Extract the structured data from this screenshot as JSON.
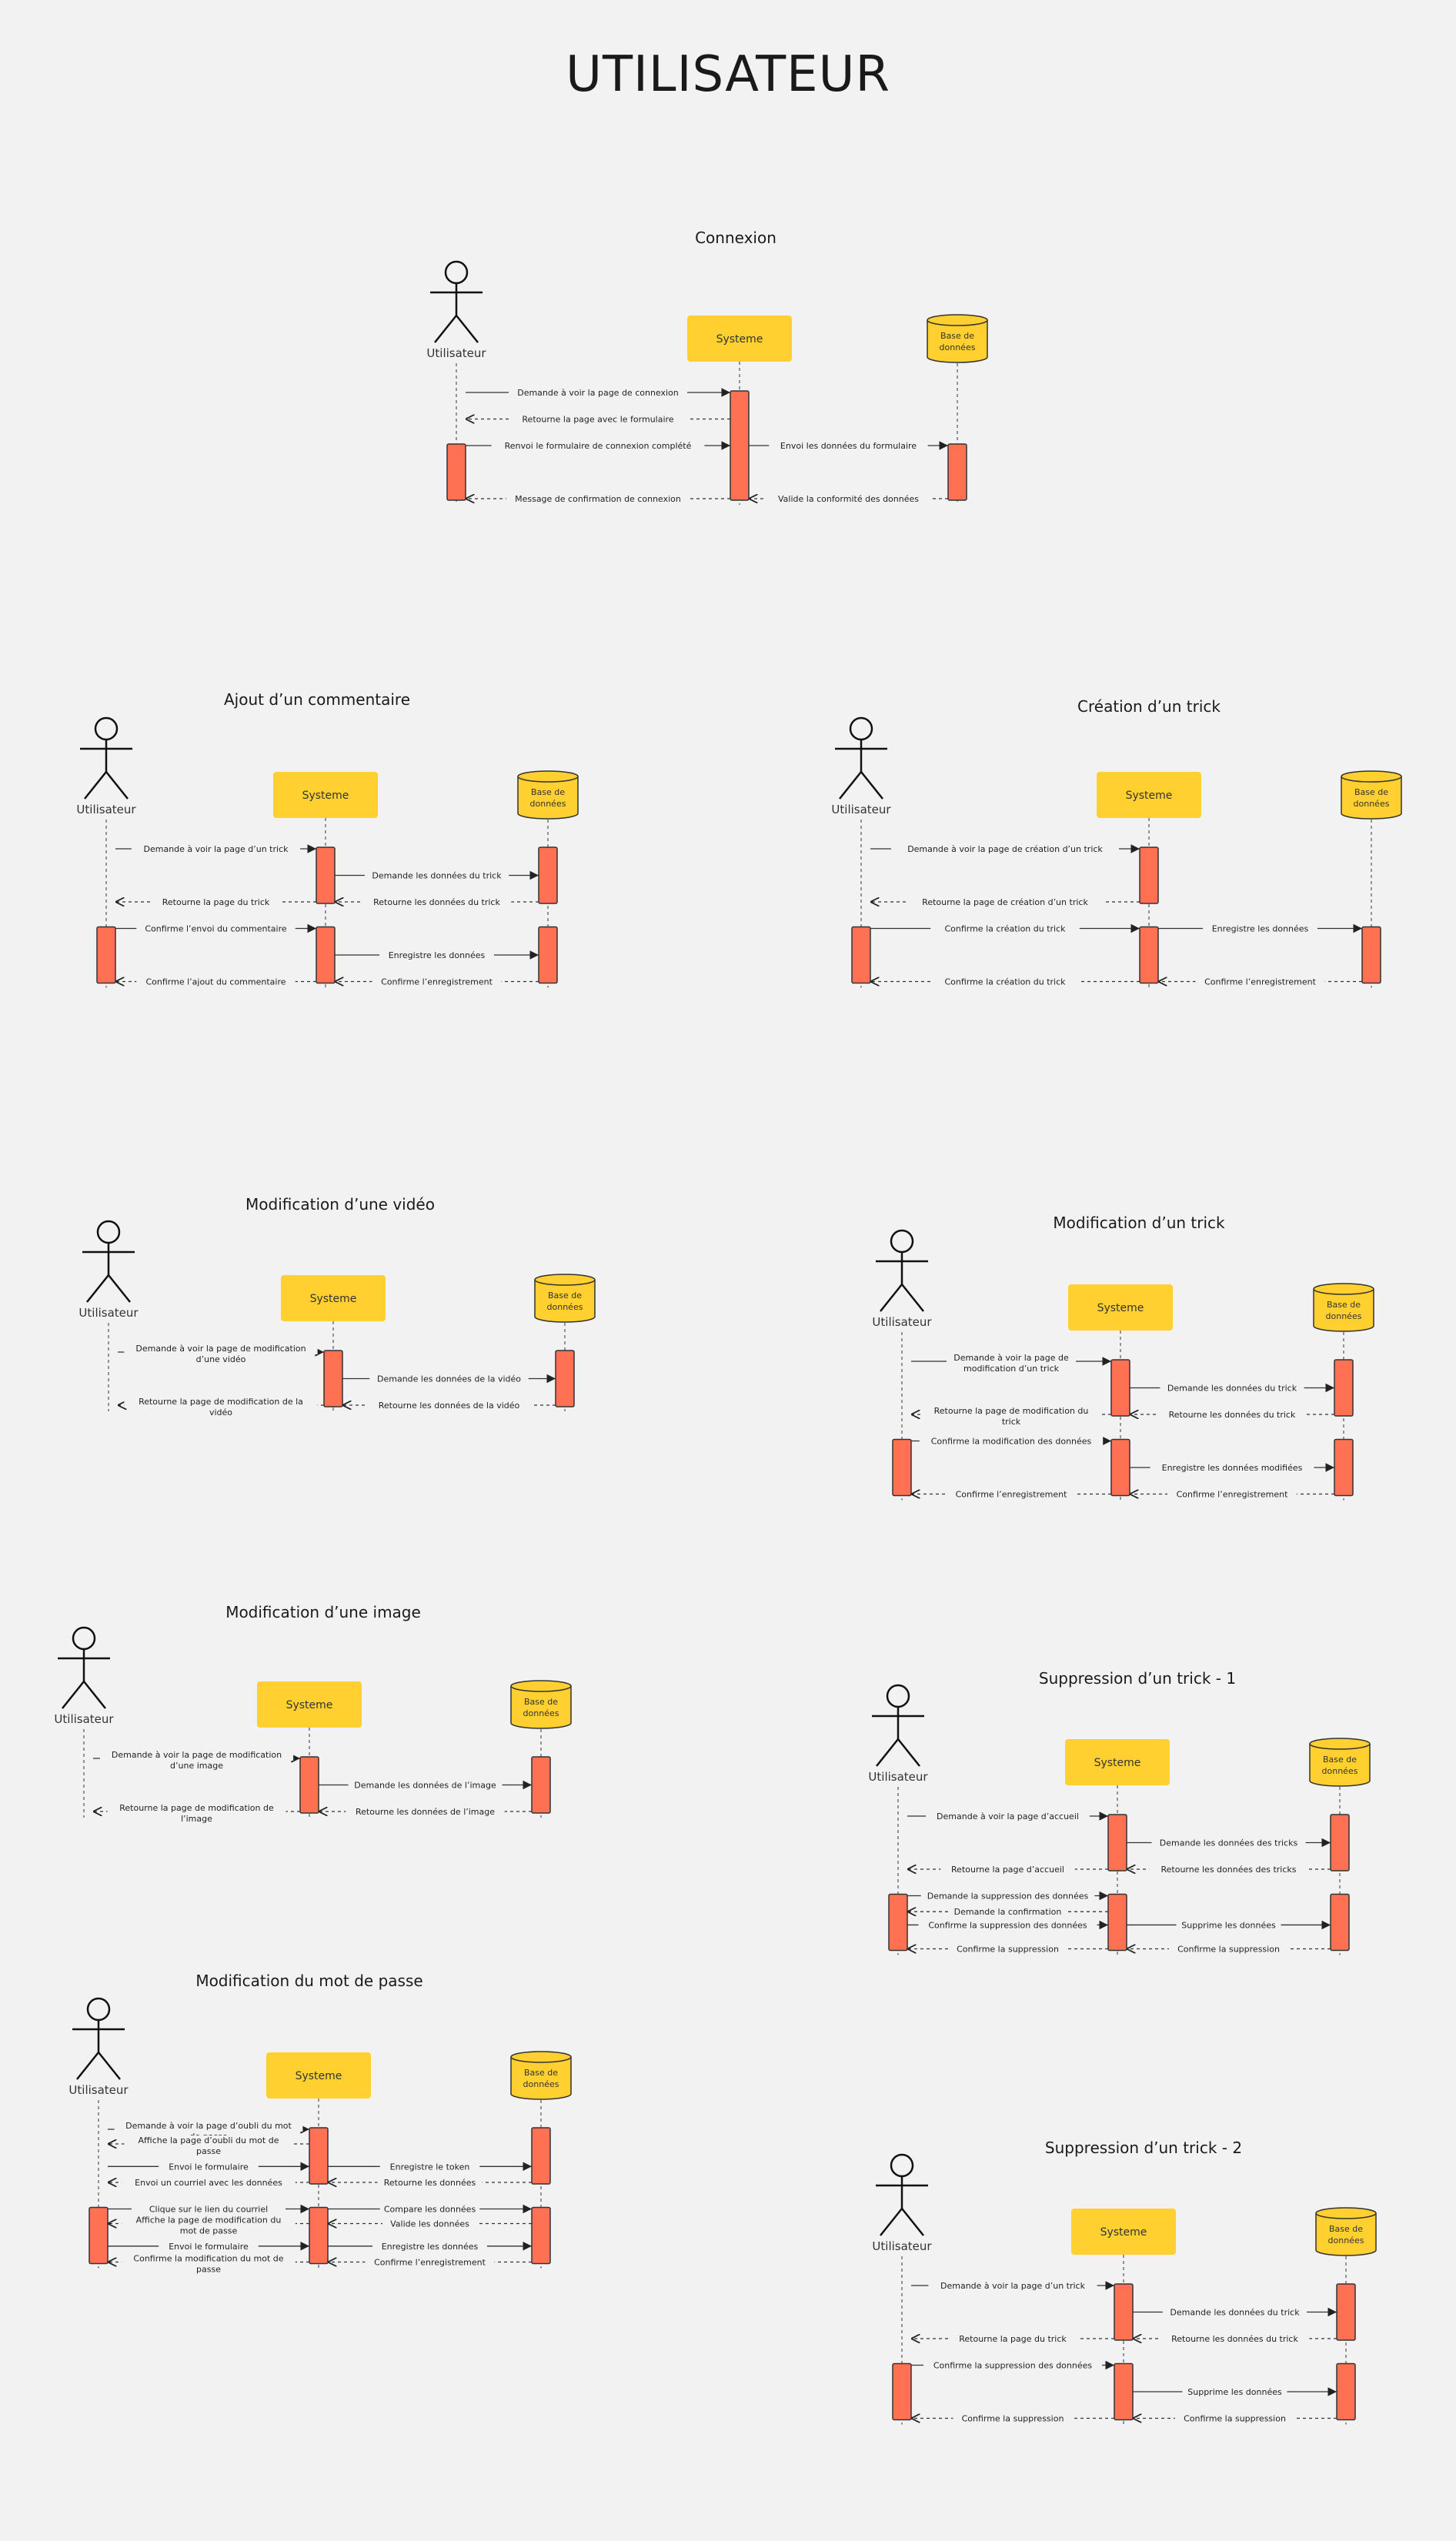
{
  "title": "UTILISATEUR",
  "colors": {
    "background": "#f2f2f2",
    "system_box": "#ffd02f",
    "database": "#ffd02f",
    "activation": "#ff7152",
    "line": "#333333"
  },
  "labels": {
    "actor": "Utilisateur",
    "system": "Systeme",
    "database": "Base de données"
  },
  "diagrams": [
    {
      "id": "connexion",
      "title": "Connexion",
      "activations": [
        {
          "lane": "S",
          "start": 0,
          "end": 4
        },
        {
          "lane": "U",
          "start": 2,
          "end": 4
        },
        {
          "lane": "D",
          "start": 2,
          "end": 4
        }
      ],
      "messages": [
        {
          "row": 0,
          "from": "U",
          "to": "S",
          "text": "Demande à voir la page de connexion",
          "type": "sync"
        },
        {
          "row": 1,
          "from": "S",
          "to": "U",
          "text": "Retourne la page avec le formulaire",
          "type": "return"
        },
        {
          "row": 2,
          "from": "U",
          "to": "S",
          "text": "Renvoi le formulaire de connexion complété",
          "type": "sync"
        },
        {
          "row": 2,
          "from": "S",
          "to": "D",
          "text": "Envoi les données du formulaire",
          "type": "sync"
        },
        {
          "row": 4,
          "from": "S",
          "to": "U",
          "text": "Message de confirmation de connexion",
          "type": "return"
        },
        {
          "row": 4,
          "from": "D",
          "to": "S",
          "text": "Valide la conformité des données",
          "type": "return"
        }
      ]
    },
    {
      "id": "ajout-commentaire",
      "title": "Ajout d’un commentaire",
      "activations": [
        {
          "lane": "S",
          "start": 0,
          "end": 2
        },
        {
          "lane": "D",
          "start": 0,
          "end": 2
        },
        {
          "lane": "U",
          "start": 3,
          "end": 5
        },
        {
          "lane": "S",
          "start": 3,
          "end": 5
        },
        {
          "lane": "D",
          "start": 3,
          "end": 5
        }
      ],
      "messages": [
        {
          "row": 0,
          "from": "U",
          "to": "S",
          "text": "Demande à voir la page d’un trick",
          "type": "sync"
        },
        {
          "row": 1,
          "from": "S",
          "to": "D",
          "text": "Demande les données du trick",
          "type": "sync"
        },
        {
          "row": 2,
          "from": "S",
          "to": "U",
          "text": "Retourne la page du trick",
          "type": "return"
        },
        {
          "row": 2,
          "from": "D",
          "to": "S",
          "text": "Retourne les données du trick",
          "type": "return"
        },
        {
          "row": 3,
          "from": "U",
          "to": "S",
          "text": "Confirme l’envoi du commentaire",
          "type": "sync"
        },
        {
          "row": 4,
          "from": "S",
          "to": "D",
          "text": "Enregistre les données",
          "type": "sync"
        },
        {
          "row": 5,
          "from": "S",
          "to": "U",
          "text": "Confirme l’ajout du commentaire",
          "type": "return"
        },
        {
          "row": 5,
          "from": "D",
          "to": "S",
          "text": "Confirme l’enregistrement",
          "type": "return"
        }
      ]
    },
    {
      "id": "creation-trick",
      "title": "Création d’un trick",
      "activations": [
        {
          "lane": "S",
          "start": 0,
          "end": 2
        },
        {
          "lane": "U",
          "start": 3,
          "end": 5
        },
        {
          "lane": "S",
          "start": 3,
          "end": 5
        },
        {
          "lane": "D",
          "start": 3,
          "end": 5
        }
      ],
      "messages": [
        {
          "row": 0,
          "from": "U",
          "to": "S",
          "text": "Demande à voir la page de création d’un trick",
          "type": "sync"
        },
        {
          "row": 2,
          "from": "S",
          "to": "U",
          "text": "Retourne la page de création d’un trick",
          "type": "return"
        },
        {
          "row": 3,
          "from": "U",
          "to": "S",
          "text": "Confirme la création du trick",
          "type": "sync"
        },
        {
          "row": 3,
          "from": "S",
          "to": "D",
          "text": "Enregistre les données",
          "type": "sync"
        },
        {
          "row": 5,
          "from": "S",
          "to": "U",
          "text": "Confirme la création du trick",
          "type": "return"
        },
        {
          "row": 5,
          "from": "D",
          "to": "S",
          "text": "Confirme l’enregistrement",
          "type": "return"
        }
      ]
    },
    {
      "id": "modification-video",
      "title": "Modification d’une vidéo",
      "activations": [
        {
          "lane": "S",
          "start": 0,
          "end": 2
        },
        {
          "lane": "D",
          "start": 0,
          "end": 2
        }
      ],
      "messages": [
        {
          "row": 0,
          "from": "U",
          "to": "S",
          "text": "Demande à voir la page de modification d’une vidéo",
          "type": "sync"
        },
        {
          "row": 1,
          "from": "S",
          "to": "D",
          "text": "Demande les données de la vidéo",
          "type": "sync"
        },
        {
          "row": 2,
          "from": "S",
          "to": "U",
          "text": "Retourne la page de modification de la vidéo",
          "type": "return"
        },
        {
          "row": 2,
          "from": "D",
          "to": "S",
          "text": "Retourne les données de la vidéo",
          "type": "return"
        }
      ]
    },
    {
      "id": "modification-trick",
      "title": "Modification d’un trick",
      "activations": [
        {
          "lane": "S",
          "start": 0,
          "end": 2
        },
        {
          "lane": "D",
          "start": 0,
          "end": 2
        },
        {
          "lane": "U",
          "start": 3,
          "end": 5
        },
        {
          "lane": "S",
          "start": 3,
          "end": 5
        },
        {
          "lane": "D",
          "start": 3,
          "end": 5
        }
      ],
      "messages": [
        {
          "row": 0,
          "from": "U",
          "to": "S",
          "text": "Demande à voir la page  de modification d’un trick",
          "type": "sync"
        },
        {
          "row": 1,
          "from": "S",
          "to": "D",
          "text": "Demande les données du trick",
          "type": "sync"
        },
        {
          "row": 2,
          "from": "S",
          "to": "U",
          "text": "Retourne la page  de modification du trick",
          "type": "return"
        },
        {
          "row": 2,
          "from": "D",
          "to": "S",
          "text": "Retourne les données du trick",
          "type": "return"
        },
        {
          "row": 3,
          "from": "U",
          "to": "S",
          "text": "Confirme la modification des données",
          "type": "sync"
        },
        {
          "row": 4,
          "from": "S",
          "to": "D",
          "text": "Enregistre les données modifiées",
          "type": "sync"
        },
        {
          "row": 5,
          "from": "S",
          "to": "U",
          "text": "Confirme l’enregistrement",
          "type": "return"
        },
        {
          "row": 5,
          "from": "D",
          "to": "S",
          "text": "Confirme l’enregistrement",
          "type": "return"
        }
      ]
    },
    {
      "id": "modification-image",
      "title": "Modification d’une image",
      "activations": [
        {
          "lane": "S",
          "start": 0,
          "end": 2
        },
        {
          "lane": "D",
          "start": 0,
          "end": 2
        }
      ],
      "messages": [
        {
          "row": 0,
          "from": "U",
          "to": "S",
          "text": "Demande à voir la page de modification d’une image",
          "type": "sync"
        },
        {
          "row": 1,
          "from": "S",
          "to": "D",
          "text": "Demande les données de l’image",
          "type": "sync"
        },
        {
          "row": 2,
          "from": "S",
          "to": "U",
          "text": "Retourne la page de modification de l’image",
          "type": "return"
        },
        {
          "row": 2,
          "from": "D",
          "to": "S",
          "text": "Retourne les données de l’image",
          "type": "return"
        }
      ]
    },
    {
      "id": "suppression-trick-1",
      "title": "Suppression d’un trick - 1",
      "activations": [
        {
          "lane": "S",
          "start": 0,
          "end": 2
        },
        {
          "lane": "D",
          "start": 0,
          "end": 2
        },
        {
          "lane": "U",
          "start": 3,
          "end": 5
        },
        {
          "lane": "S",
          "start": 3,
          "end": 5
        },
        {
          "lane": "D",
          "start": 3,
          "end": 5
        }
      ],
      "messages": [
        {
          "row": 0,
          "from": "U",
          "to": "S",
          "text": "Demande à voir la page d’accueil",
          "type": "sync"
        },
        {
          "row": 1,
          "from": "S",
          "to": "D",
          "text": "Demande les données des tricks",
          "type": "sync"
        },
        {
          "row": 2,
          "from": "S",
          "to": "U",
          "text": "Retourne la page d’accueil",
          "type": "return"
        },
        {
          "row": 2,
          "from": "D",
          "to": "S",
          "text": "Retourne les données des tricks",
          "type": "return"
        },
        {
          "row": 3,
          "from": "U",
          "to": "S",
          "text": "Demande la suppression des données",
          "type": "sync"
        },
        {
          "row": 3.6,
          "from": "S",
          "to": "U",
          "text": "Demande la confirmation",
          "type": "return"
        },
        {
          "row": 4.1,
          "from": "U",
          "to": "S",
          "text": "Confirme la suppression des données",
          "type": "sync"
        },
        {
          "row": 4.1,
          "from": "S",
          "to": "D",
          "text": "Supprime les données",
          "type": "sync"
        },
        {
          "row": 5,
          "from": "S",
          "to": "U",
          "text": "Confirme la suppression",
          "type": "return"
        },
        {
          "row": 5,
          "from": "D",
          "to": "S",
          "text": "Confirme la suppression",
          "type": "return"
        }
      ]
    },
    {
      "id": "modification-mot-de-passe",
      "title": "Modification du mot de passe",
      "activations": [
        {
          "lane": "S",
          "start": 0,
          "end": 2
        },
        {
          "lane": "D",
          "start": 0,
          "end": 2
        },
        {
          "lane": "U",
          "start": 3,
          "end": 5
        },
        {
          "lane": "S",
          "start": 3,
          "end": 5
        },
        {
          "lane": "D",
          "start": 3,
          "end": 5
        }
      ],
      "messages": [
        {
          "row": 0,
          "from": "U",
          "to": "S",
          "text": "Demande à voir la page d’oubli du mot de passe",
          "type": "sync"
        },
        {
          "row": 0.55,
          "from": "S",
          "to": "U",
          "text": "Affiche la page d’oubli du mot de passe",
          "type": "return"
        },
        {
          "row": 1.4,
          "from": "U",
          "to": "S",
          "text": "Envoi le formulaire",
          "type": "sync"
        },
        {
          "row": 1.4,
          "from": "S",
          "to": "D",
          "text": "Enregistre le token",
          "type": "sync"
        },
        {
          "row": 2,
          "from": "S",
          "to": "U",
          "text": "Envoi un courriel avec les données",
          "type": "return"
        },
        {
          "row": 2,
          "from": "D",
          "to": "S",
          "text": "Retourne les données",
          "type": "return"
        },
        {
          "row": 3,
          "from": "U",
          "to": "S",
          "text": "Clique sur le lien du courriel",
          "type": "sync"
        },
        {
          "row": 3,
          "from": "S",
          "to": "D",
          "text": "Compare les données",
          "type": "sync"
        },
        {
          "row": 3.55,
          "from": "S",
          "to": "U",
          "text": "Affiche la page de modification du mot de passe",
          "type": "return"
        },
        {
          "row": 3.55,
          "from": "D",
          "to": "S",
          "text": "Valide les données",
          "type": "return"
        },
        {
          "row": 4.4,
          "from": "U",
          "to": "S",
          "text": "Envoi le formulaire",
          "type": "sync"
        },
        {
          "row": 4.4,
          "from": "S",
          "to": "D",
          "text": "Enregistre les données",
          "type": "sync"
        },
        {
          "row": 5,
          "from": "S",
          "to": "U",
          "text": "Confirme la modification du mot de passe",
          "type": "return"
        },
        {
          "row": 5,
          "from": "D",
          "to": "S",
          "text": "Confirme l’enregistrement",
          "type": "return"
        }
      ]
    },
    {
      "id": "suppression-trick-2",
      "title": "Suppression d’un trick - 2",
      "activations": [
        {
          "lane": "S",
          "start": 0,
          "end": 2
        },
        {
          "lane": "D",
          "start": 0,
          "end": 2
        },
        {
          "lane": "U",
          "start": 3,
          "end": 5
        },
        {
          "lane": "S",
          "start": 3,
          "end": 5
        },
        {
          "lane": "D",
          "start": 3,
          "end": 5
        }
      ],
      "messages": [
        {
          "row": 0,
          "from": "U",
          "to": "S",
          "text": "Demande à voir la page d’un trick",
          "type": "sync"
        },
        {
          "row": 1,
          "from": "S",
          "to": "D",
          "text": "Demande les données du trick",
          "type": "sync"
        },
        {
          "row": 2,
          "from": "S",
          "to": "U",
          "text": "Retourne la page du trick",
          "type": "return"
        },
        {
          "row": 2,
          "from": "D",
          "to": "S",
          "text": "Retourne les données du trick",
          "type": "return"
        },
        {
          "row": 3,
          "from": "U",
          "to": "S",
          "text": "Confirme la suppression des données",
          "type": "sync"
        },
        {
          "row": 4,
          "from": "S",
          "to": "D",
          "text": "Supprime les données",
          "type": "sync"
        },
        {
          "row": 5,
          "from": "S",
          "to": "U",
          "text": "Confirme la suppression",
          "type": "return"
        },
        {
          "row": 5,
          "from": "D",
          "to": "S",
          "text": "Confirme la suppression",
          "type": "return"
        }
      ]
    }
  ]
}
